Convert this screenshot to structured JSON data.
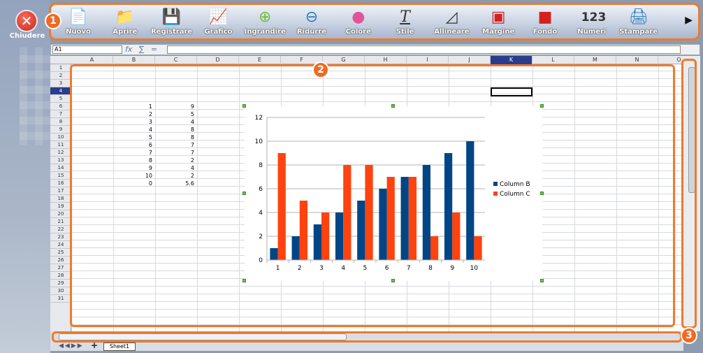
{
  "app": {
    "close_label": "Chiudere"
  },
  "callouts": [
    "1",
    "2",
    "3"
  ],
  "toolbar": {
    "items": [
      {
        "label": "Nuovo",
        "icon": "new-document-icon"
      },
      {
        "label": "Aprire",
        "icon": "open-folder-icon"
      },
      {
        "label": "Registrare",
        "icon": "save-icon"
      },
      {
        "label": "Grafico",
        "icon": "chart-icon"
      },
      {
        "label": "Ingrandire",
        "icon": "zoom-in-icon"
      },
      {
        "label": "Ridurre",
        "icon": "zoom-out-icon"
      },
      {
        "label": "Colore",
        "icon": "color-icon"
      },
      {
        "label": "Stile",
        "icon": "style-icon"
      },
      {
        "label": "Allineare",
        "icon": "align-icon"
      },
      {
        "label": "Margine",
        "icon": "margin-icon"
      },
      {
        "label": "Fondo",
        "icon": "background-icon"
      },
      {
        "label": "Numeri",
        "icon": "numbers-icon"
      },
      {
        "label": "Stampare",
        "icon": "print-icon"
      }
    ],
    "numbers_glyph": "123",
    "style_glyph": "T"
  },
  "formula": {
    "cell_ref": "A1",
    "fx": "fx",
    "sigma": "∑",
    "equals": "=",
    "value": ""
  },
  "sheet": {
    "columns": [
      "A",
      "B",
      "C",
      "D",
      "E",
      "F",
      "G",
      "H",
      "I",
      "J",
      "K",
      "L",
      "M",
      "N",
      "O"
    ],
    "selected_column": "K",
    "rows": [
      "1",
      "2",
      "3",
      "4",
      "5",
      "6",
      "7",
      "8",
      "9",
      "10",
      "11",
      "12",
      "13",
      "14",
      "15",
      "16",
      "17",
      "18",
      "19",
      "20",
      "21",
      "22",
      "23",
      "24",
      "25",
      "26",
      "27",
      "28",
      "29",
      "30",
      "31"
    ],
    "selected_row": "4",
    "tab_name": "Sheet1",
    "data_b": [
      "1",
      "2",
      "3",
      "4",
      "5",
      "6",
      "7",
      "8",
      "9",
      "10",
      "0"
    ],
    "data_c": [
      "9",
      "5",
      "4",
      "8",
      "8",
      "7",
      "7",
      "2",
      "4",
      "2",
      "5.6"
    ]
  },
  "chart_data": {
    "type": "bar",
    "categories": [
      "1",
      "2",
      "3",
      "4",
      "5",
      "6",
      "7",
      "8",
      "9",
      "10"
    ],
    "series": [
      {
        "name": "Column B",
        "values": [
          1,
          2,
          3,
          4,
          5,
          6,
          7,
          8,
          9,
          10
        ],
        "color": "#004586"
      },
      {
        "name": "Column C",
        "values": [
          9,
          5,
          4,
          8,
          8,
          7,
          7,
          2,
          4,
          2
        ],
        "color": "#ff420e"
      }
    ],
    "ylim": [
      0,
      12
    ],
    "yticks": [
      "0",
      "2",
      "4",
      "6",
      "8",
      "10",
      "12"
    ],
    "legend": "right",
    "grid": true
  }
}
